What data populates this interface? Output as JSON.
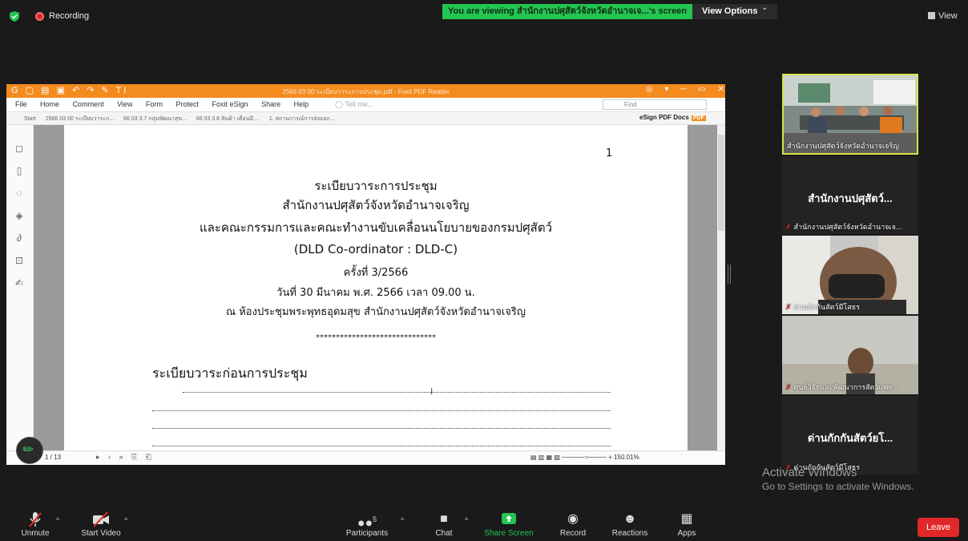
{
  "topbar": {
    "recording_label": "Recording",
    "viewing_banner": "You are viewing สำนักงานปศุสัตว์จังหวัดอำนาจเจ...'s screen",
    "view_options_label": "View Options",
    "view_label": "View"
  },
  "foxit": {
    "title": "2566 03 00 ระเบียบวาระการประชุม.pdf - Foxit PDF Reader",
    "menu": [
      "File",
      "Home",
      "Comment",
      "View",
      "Form",
      "Protect",
      "Foxit eSign",
      "Share",
      "Help"
    ],
    "tell_me": "Tell me...",
    "find_placeholder": "Find",
    "tabs": [
      "Start",
      "2566 03 00 ระเบียบวาระก...",
      "66 03 3.7 กลุ่มพัฒนาสุข...",
      "66 03 3.8 สินค้า เดือนมี....",
      "1. สถานการณ์การส่งออก..."
    ],
    "esign_label": "eSign PDF Docs",
    "esign_badge": "PDF",
    "page_indicator": "1 / 13",
    "zoom_level": "150.01%"
  },
  "document": {
    "page_number": "1",
    "title_line1": "ระเบียบวาระการประชุม",
    "title_line2": "สำนักงานปศุสัตว์จังหวัดอำนาจเจริญ",
    "title_line3": "และคณะกรรมการและคณะทำงานขับเคลื่อนนโยบายของกรมปศุสัตว์",
    "title_line4": "(DLD Co-ordinator : DLD-C)",
    "title_line5": "ครั้งที่ 3/2566",
    "date_line": "วันที่ 30 มีนาคม พ.ศ. 2566 เวลา 09.00 น.",
    "venue_line": "ณ ห้องประชุมพระพุทธอุดมสุข สำนักงานปศุสัตว์จังหวัดอำนาจเจริญ",
    "separator": "******************************",
    "agenda_heading": "ระเบียบวาระก่อนการประชุม"
  },
  "participants": [
    {
      "name": "สำนักงานปศุสัตว์จังหวัดอำนาจเจริญ",
      "kind": "video"
    },
    {
      "name": "สำนักงานปศุสัตว์จังหวัดอำนาจเจ...",
      "display_title": "สำนักงานปศุสัตว์...",
      "kind": "name"
    },
    {
      "name": "ด่านกักกันสัตว์มีโสธร",
      "kind": "video"
    },
    {
      "name": "ศูนย์วิจัยและพัฒนาการสัตว์แพท...",
      "kind": "video"
    },
    {
      "name": "ด่านกักกันสัตว์มีโสธร",
      "display_title": "ด่านกักกันสัตว์ยโ...",
      "kind": "name"
    }
  ],
  "windows_watermark": {
    "line1": "Activate Windows",
    "line2": "Go to Settings to activate Windows."
  },
  "toolbar": {
    "unmute": "Unmute",
    "start_video": "Start Video",
    "participants": "Participants",
    "participants_count": "5",
    "chat": "Chat",
    "share_screen": "Share Screen",
    "record": "Record",
    "reactions": "Reactions",
    "apps": "Apps",
    "leave": "Leave"
  },
  "colors": {
    "share_green": "#23c552",
    "foxit_orange": "#f38b1f",
    "leave_red": "#e02828"
  }
}
